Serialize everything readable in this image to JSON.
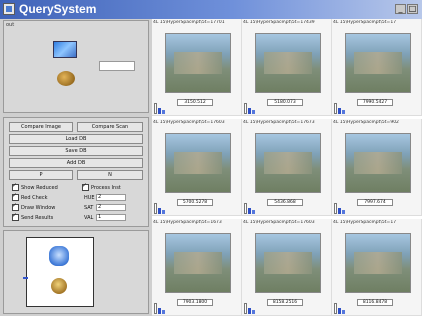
{
  "window": {
    "title": "QuerySystem"
  },
  "query_panel": {
    "label": "out"
  },
  "controls": {
    "compare_image": "Compare Image",
    "compare_scan": "Compare Scan",
    "load_db": "Load DB",
    "save_db": "Save DB",
    "add_db": "Add DB",
    "prev": "P",
    "next": "N",
    "show_reduced": "Show Reduced",
    "process_inst": "Process Inst",
    "red_check": "Red Check",
    "draw_window": "Draw Window",
    "send_results": "Send Results",
    "hue_label": "HUE",
    "hue_value": "2",
    "sat_label": "SAT",
    "sat_value": "2",
    "val_label": "VAL",
    "val_value": "1"
  },
  "results": [
    {
      "caption": "4L 15\\HyperSpace\\pt\\5t=17701",
      "score": "3150.512"
    },
    {
      "caption": "4L 15\\HyperSpace\\pt\\5t=17439",
      "score": "5180.073"
    },
    {
      "caption": "4L 15\\HyperSpace\\pt\\5t=17",
      "score": "7990.5427"
    },
    {
      "caption": "4L 15\\HyperSpace\\pt\\5t=17603",
      "score": "5700.5278"
    },
    {
      "caption": "4L 15\\HyperSpace\\pt\\5t=17673",
      "score": "5436.868"
    },
    {
      "caption": "4L 15\\HyperSpace\\pt\\5t=902",
      "score": "7997.674"
    },
    {
      "caption": "4L 15\\HyperSpace\\pt\\5t=1673",
      "score": "7903.1800"
    },
    {
      "caption": "4L 15\\HyperSpace\\pt\\5t=17603",
      "score": "8158.2516"
    },
    {
      "caption": "4L 15\\HyperSpace\\pt\\5t=17",
      "score": "8116.8478"
    }
  ]
}
